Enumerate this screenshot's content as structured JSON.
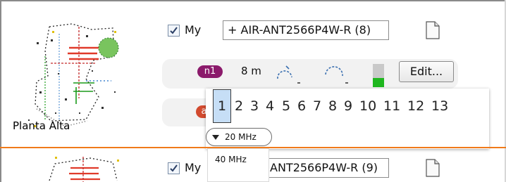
{
  "floors": [
    {
      "floor_label": "Planta Alta",
      "checkbox_label": "My",
      "checkbox_checked": true,
      "antenna_field": "+ AIR-ANT2566P4W-R (8)",
      "radios": [
        {
          "badge": "n1",
          "badge_color": "#8b1a6b",
          "distance": "8 m",
          "signal_level": 0.4
        },
        {
          "badge": "ac",
          "badge_color": "#d24a2e"
        }
      ],
      "edit_label": "Edit..."
    },
    {
      "checkbox_label": "My",
      "checkbox_checked": true,
      "antenna_field": "ANT2566P4W-R (9)"
    }
  ],
  "channel_popup": {
    "channels": [
      "1",
      "2",
      "3",
      "4",
      "5",
      "6",
      "7",
      "8",
      "9",
      "10",
      "11",
      "12",
      "13"
    ],
    "selected_channel": "1",
    "bandwidth_selected": "20 MHz",
    "bandwidth_option": "40 MHz"
  },
  "colors": {
    "row_separator": "#f07a1a",
    "selected_channel_bg": "#c6def6",
    "signal_fill": "#1fb71f"
  },
  "icons": [
    "document-icon",
    "coverage-arc-icon",
    "dropdown-triangle-icon"
  ]
}
